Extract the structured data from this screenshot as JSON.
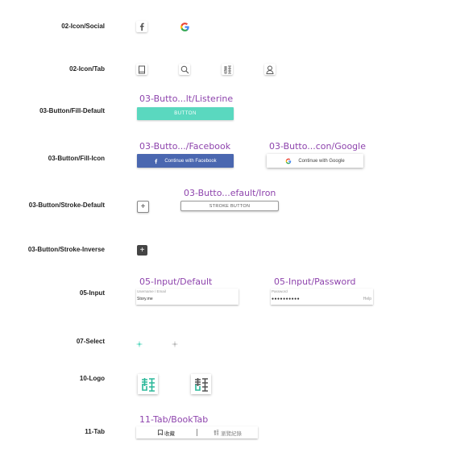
{
  "rows": {
    "icon_social": "02-Icon/Social",
    "icon_tab": "02-Icon/Tab",
    "button_fill_default": "03-Button/Fill-Default",
    "button_fill_icon": "03-Button/Fill-Icon",
    "button_stroke_default": "03-Button/Stroke-Default",
    "button_stroke_inverse": "03-Button/Stroke-Inverse",
    "input": "05-Input",
    "select": "07-Select",
    "logo": "10-Logo",
    "tab": "11-Tab"
  },
  "frames": {
    "listerine": "03-Butto...lt/Listerine",
    "facebook": "03-Butto.../Facebook",
    "google": "03-Butto...con/Google",
    "iron": "03-Butto...efault/Iron",
    "input_default": "05-Input/Default",
    "input_password": "05-Input/Password",
    "booktab": "11-Tab/BookTab"
  },
  "buttons": {
    "fill_default": "BUTTON",
    "facebook": "Continue with Facebook",
    "google": "Continue with Google",
    "stroke": "STROKE BUTTON",
    "stroke_plus": "+",
    "inverse_plus": "+"
  },
  "inputs": {
    "default": {
      "placeholder": "Username / Email",
      "value": "Story.me"
    },
    "password": {
      "placeholder": "Password",
      "value": "●●●●●●●●●●",
      "help": "Help"
    }
  },
  "booktab": {
    "tab1": "收藏",
    "tab2": "瀏覽紀錄"
  },
  "icons": [
    "facebook-icon",
    "google-icon",
    "book-icon",
    "search-icon",
    "story-icon",
    "user-icon"
  ],
  "colors": {
    "accent": "#5ad8bf",
    "facebook": "#4a67b0",
    "frame_title": "#8e44ad",
    "inverse": "#444444"
  }
}
